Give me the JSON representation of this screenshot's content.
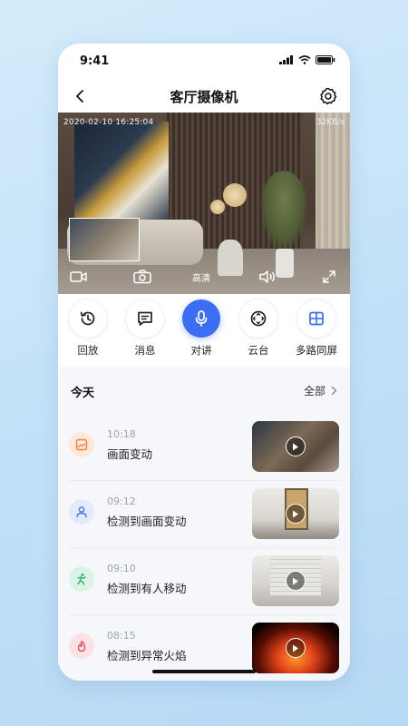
{
  "status_bar": {
    "time": "9:41"
  },
  "nav": {
    "title": "客厅摄像机"
  },
  "video": {
    "timestamp": "2020-02-10 16:25:04",
    "speed": "32KB/s",
    "quality_label": "高清"
  },
  "actions": [
    {
      "label": "回放",
      "icon": "history-icon"
    },
    {
      "label": "消息",
      "icon": "message-icon"
    },
    {
      "label": "对讲",
      "icon": "microphone-icon",
      "active": true
    },
    {
      "label": "云台",
      "icon": "ptz-control-icon"
    },
    {
      "label": "多路同屏",
      "icon": "grid-icon"
    }
  ],
  "events": {
    "header": "今天",
    "all_label": "全部",
    "items": [
      {
        "time": "10:18",
        "description": "画面变动",
        "icon": "image-change-icon",
        "icon_color": "#f07f3c",
        "icon_bg": "#fde8dc"
      },
      {
        "time": "09:12",
        "description": "检测到画面变动",
        "icon": "person-icon",
        "icon_color": "#4a74e8",
        "icon_bg": "#e3ebfb"
      },
      {
        "time": "09:10",
        "description": "检测到有人移动",
        "icon": "running-person-icon",
        "icon_color": "#1fb36b",
        "icon_bg": "#dcf4e8"
      },
      {
        "time": "08:15",
        "description": "检测到异常火焰",
        "icon": "flame-icon",
        "icon_color": "#e8465a",
        "icon_bg": "#fde1e5"
      }
    ]
  },
  "colors": {
    "accent": "#3b6ef5",
    "background": "#c4e2f8"
  }
}
